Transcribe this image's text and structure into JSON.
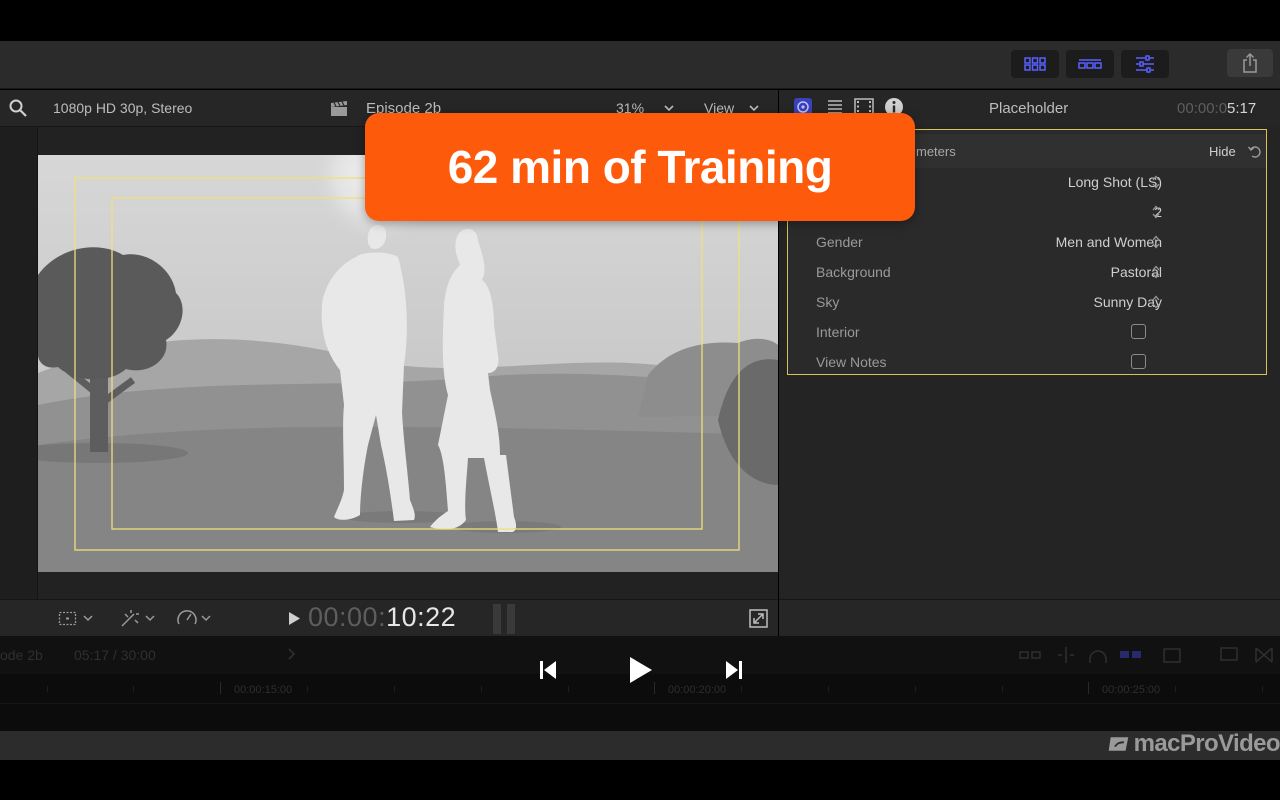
{
  "viewer": {
    "format": "1080p HD 30p, Stereo",
    "project_name": "Episode 2b",
    "zoom": "31%",
    "view_label": "View",
    "timecode_dim": "00:00:",
    "timecode_bright": "10:22"
  },
  "inspector": {
    "title": "Placeholder",
    "duration_dim": "00:00:0",
    "duration_bright": "5:17",
    "section_title_partial": "meters",
    "hide_label": "Hide",
    "params": [
      {
        "label": "",
        "value": "Long Shot (LS)",
        "kind": "popup"
      },
      {
        "label": "",
        "value": "2",
        "kind": "popup"
      },
      {
        "label": "Gender",
        "value": "Men and Women",
        "kind": "popup"
      },
      {
        "label": "Background",
        "value": "Pastoral",
        "kind": "popup"
      },
      {
        "label": "Sky",
        "value": "Sunny Day",
        "kind": "popup"
      },
      {
        "label": "Interior",
        "value": "",
        "kind": "checkbox"
      },
      {
        "label": "View Notes",
        "value": "",
        "kind": "checkbox"
      }
    ]
  },
  "timeline": {
    "project_partial": "ode 2b",
    "position": "05:17 / 30:00",
    "ruler": [
      "00:00:15:00",
      "00:00:20:00",
      "00:00:25:00"
    ]
  },
  "promo": {
    "text": "62 min of Training"
  },
  "watermark": {
    "brand": "macProVideo"
  },
  "colors": {
    "accent_blue": "#5860ff",
    "promo_orange": "#fd5a0c",
    "selection_yellow": "#d9c451"
  },
  "icons": {
    "toolbar": [
      "library-browser-icon",
      "timeline-icon",
      "inspector-icon",
      "share-icon"
    ],
    "inspector_tabs": [
      "generator-icon",
      "list-icon",
      "film-icon",
      "info-icon"
    ],
    "playback": [
      "skip-back-icon",
      "play-icon",
      "skip-forward-icon"
    ]
  }
}
